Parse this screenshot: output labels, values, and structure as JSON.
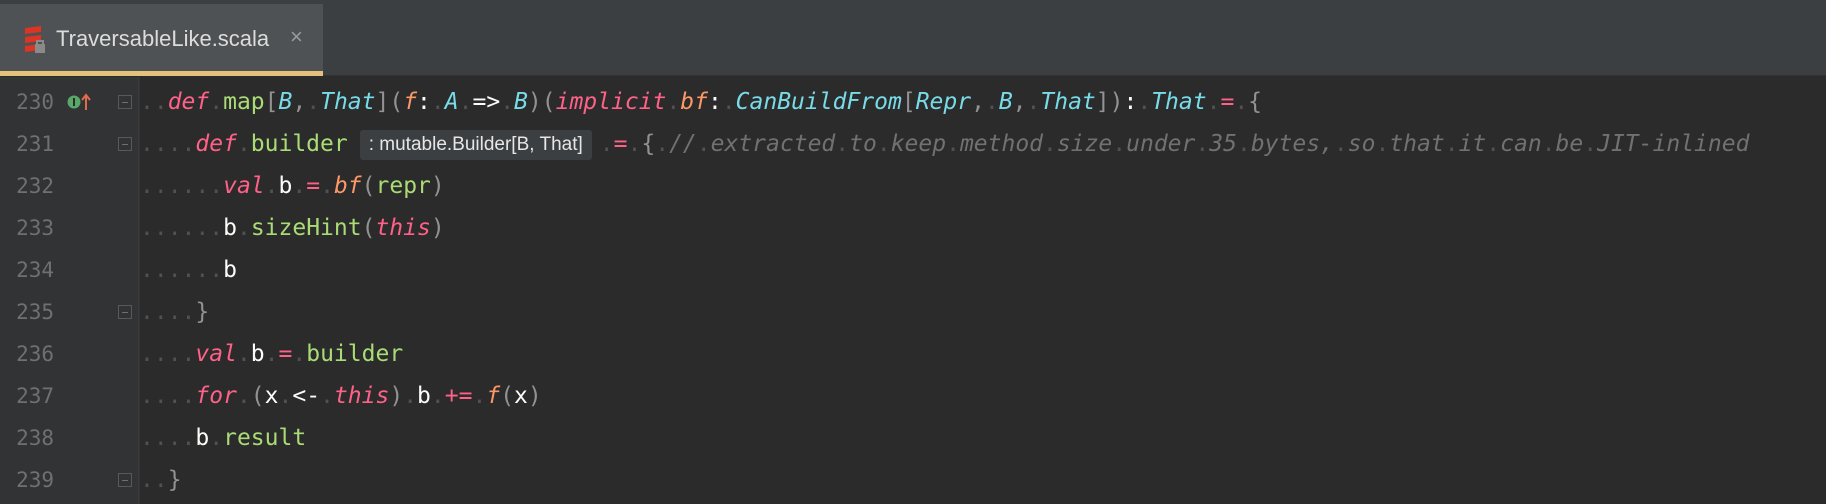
{
  "tab": {
    "filename": "TraversableLike.scala",
    "close_glyph": "×",
    "file_icon": "scala-icon",
    "active_underline_color": "#e5c07b"
  },
  "gutter": {
    "override_marker_icon": "implements-override-icon",
    "marker_color": "#59a869"
  },
  "lines": [
    {
      "num": "230",
      "marker": true,
      "fold": true
    },
    {
      "num": "231",
      "marker": false,
      "fold": true
    },
    {
      "num": "232",
      "marker": false,
      "fold": false
    },
    {
      "num": "233",
      "marker": false,
      "fold": false
    },
    {
      "num": "234",
      "marker": false,
      "fold": false
    },
    {
      "num": "235",
      "marker": false,
      "fold": true
    },
    {
      "num": "236",
      "marker": false,
      "fold": false
    },
    {
      "num": "237",
      "marker": false,
      "fold": false
    },
    {
      "num": "238",
      "marker": false,
      "fold": false
    },
    {
      "num": "239",
      "marker": false,
      "fold": true
    }
  ],
  "code": [
    [
      [
        "ws",
        ".."
      ],
      [
        "kw",
        "def"
      ],
      [
        "ws",
        "."
      ],
      [
        "fn",
        "map"
      ],
      [
        "br",
        "["
      ],
      [
        "ty",
        "B"
      ],
      [
        "br",
        ","
      ],
      [
        "ws",
        "."
      ],
      [
        "ty",
        "That"
      ],
      [
        "br",
        "]("
      ],
      [
        "pm",
        "f"
      ],
      [
        "wh",
        ":"
      ],
      [
        "ws",
        "."
      ],
      [
        "ty",
        "A"
      ],
      [
        "ws",
        "."
      ],
      [
        "wh",
        "=>"
      ],
      [
        "ws",
        "."
      ],
      [
        "ty",
        "B"
      ],
      [
        "br",
        ")("
      ],
      [
        "kw",
        "implicit"
      ],
      [
        "ws",
        "."
      ],
      [
        "pm",
        "bf"
      ],
      [
        "wh",
        ":"
      ],
      [
        "ws",
        "."
      ],
      [
        "ty",
        "CanBuildFrom"
      ],
      [
        "br",
        "["
      ],
      [
        "ty",
        "Repr"
      ],
      [
        "br",
        ","
      ],
      [
        "ws",
        "."
      ],
      [
        "ty",
        "B"
      ],
      [
        "br",
        ","
      ],
      [
        "ws",
        "."
      ],
      [
        "ty",
        "That"
      ],
      [
        "br",
        "])"
      ],
      [
        "wh",
        ":"
      ],
      [
        "ws",
        "."
      ],
      [
        "ty",
        "That"
      ],
      [
        "ws",
        "."
      ],
      [
        "op",
        "="
      ],
      [
        "ws",
        "."
      ],
      [
        "br",
        "{"
      ]
    ],
    [
      [
        "ws",
        "...."
      ],
      [
        "kw",
        "def"
      ],
      [
        "ws",
        "."
      ],
      [
        "fn",
        "builder"
      ],
      [
        "hint",
        ": mutable.Builder[B, That]"
      ],
      [
        "ws",
        "."
      ],
      [
        "op",
        "="
      ],
      [
        "ws",
        "."
      ],
      [
        "br",
        "{"
      ],
      [
        "ws",
        "."
      ],
      [
        "cm",
        "//"
      ],
      [
        "ws",
        "."
      ],
      [
        "cm",
        "extracted"
      ],
      [
        "ws",
        "."
      ],
      [
        "cm",
        "to"
      ],
      [
        "ws",
        "."
      ],
      [
        "cm",
        "keep"
      ],
      [
        "ws",
        "."
      ],
      [
        "cm",
        "method"
      ],
      [
        "ws",
        "."
      ],
      [
        "cm",
        "size"
      ],
      [
        "ws",
        "."
      ],
      [
        "cm",
        "under"
      ],
      [
        "ws",
        "."
      ],
      [
        "cm",
        "35"
      ],
      [
        "ws",
        "."
      ],
      [
        "cm",
        "bytes,"
      ],
      [
        "ws",
        "."
      ],
      [
        "cm",
        "so"
      ],
      [
        "ws",
        "."
      ],
      [
        "cm",
        "that"
      ],
      [
        "ws",
        "."
      ],
      [
        "cm",
        "it"
      ],
      [
        "ws",
        "."
      ],
      [
        "cm",
        "can"
      ],
      [
        "ws",
        "."
      ],
      [
        "cm",
        "be"
      ],
      [
        "ws",
        "."
      ],
      [
        "cm",
        "JIT-inlined"
      ]
    ],
    [
      [
        "ws",
        "......"
      ],
      [
        "kw",
        "val"
      ],
      [
        "ws",
        "."
      ],
      [
        "wh",
        "b"
      ],
      [
        "ws",
        "."
      ],
      [
        "op",
        "="
      ],
      [
        "ws",
        "."
      ],
      [
        "pm",
        "bf"
      ],
      [
        "br",
        "("
      ],
      [
        "fn",
        "repr"
      ],
      [
        "br",
        ")"
      ]
    ],
    [
      [
        "ws",
        "......"
      ],
      [
        "wh",
        "b"
      ],
      [
        "ws",
        "."
      ],
      [
        "fn",
        "sizeHint"
      ],
      [
        "br",
        "("
      ],
      [
        "kw",
        "this"
      ],
      [
        "br",
        ")"
      ]
    ],
    [
      [
        "ws",
        "......"
      ],
      [
        "wh",
        "b"
      ]
    ],
    [
      [
        "ws",
        "...."
      ],
      [
        "br",
        "}"
      ]
    ],
    [
      [
        "ws",
        "...."
      ],
      [
        "kw",
        "val"
      ],
      [
        "ws",
        "."
      ],
      [
        "wh",
        "b"
      ],
      [
        "ws",
        "."
      ],
      [
        "op",
        "="
      ],
      [
        "ws",
        "."
      ],
      [
        "fn",
        "builder"
      ]
    ],
    [
      [
        "ws",
        "...."
      ],
      [
        "kw",
        "for"
      ],
      [
        "ws",
        "."
      ],
      [
        "br",
        "("
      ],
      [
        "wh",
        "x"
      ],
      [
        "ws",
        "."
      ],
      [
        "wh",
        "<-"
      ],
      [
        "ws",
        "."
      ],
      [
        "kw",
        "this"
      ],
      [
        "br",
        ")"
      ],
      [
        "ws",
        "."
      ],
      [
        "wh",
        "b"
      ],
      [
        "ws",
        "."
      ],
      [
        "op",
        "+="
      ],
      [
        "ws",
        "."
      ],
      [
        "pm",
        "f"
      ],
      [
        "br",
        "("
      ],
      [
        "wh",
        "x"
      ],
      [
        "br",
        ")"
      ]
    ],
    [
      [
        "ws",
        "...."
      ],
      [
        "wh",
        "b"
      ],
      [
        "ws",
        "."
      ],
      [
        "fn",
        "result"
      ]
    ],
    [
      [
        "ws",
        ".."
      ],
      [
        "br",
        "}"
      ]
    ]
  ]
}
